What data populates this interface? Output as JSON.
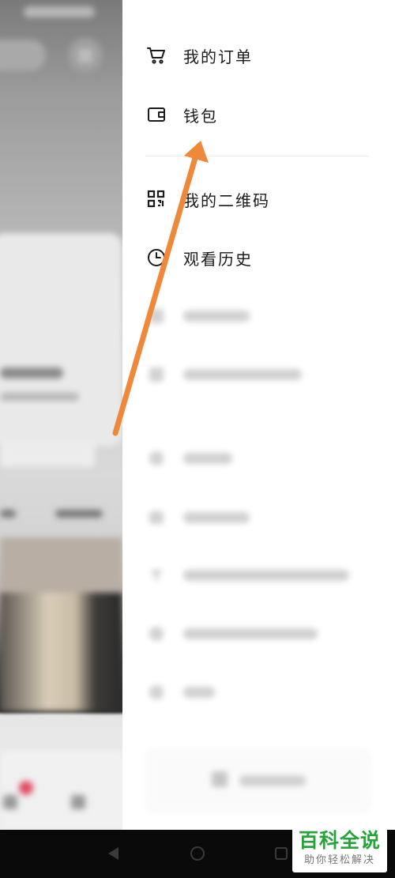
{
  "drawer": {
    "items": [
      {
        "label": "我的订单",
        "icon": "cart-icon"
      },
      {
        "label": "钱包",
        "icon": "wallet-icon"
      },
      {
        "label": "我的二维码",
        "icon": "qr-code-icon"
      },
      {
        "label": "观看历史",
        "icon": "clock-icon"
      }
    ]
  },
  "colors": {
    "drawer_bg": "#ffffff",
    "arrow": "#f0883a",
    "watermark_green": "#27a33a"
  },
  "watermark": {
    "title": "百科全说",
    "subtitle": "助你轻松解决"
  }
}
